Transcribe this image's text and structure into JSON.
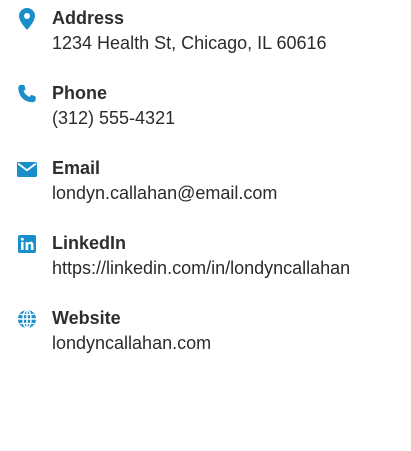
{
  "accent_color": "#1a8ec9",
  "contacts": [
    {
      "icon": "location-pin-icon",
      "label": "Address",
      "value": "1234 Health St, Chicago, IL 60616"
    },
    {
      "icon": "phone-icon",
      "label": "Phone",
      "value": "(312) 555-4321"
    },
    {
      "icon": "envelope-icon",
      "label": "Email",
      "value": "londyn.callahan@email.com"
    },
    {
      "icon": "linkedin-icon",
      "label": "LinkedIn",
      "value": "https://linkedin.com/in/londyncallahan"
    },
    {
      "icon": "globe-icon",
      "label": "Website",
      "value": "londyncallahan.com"
    }
  ]
}
